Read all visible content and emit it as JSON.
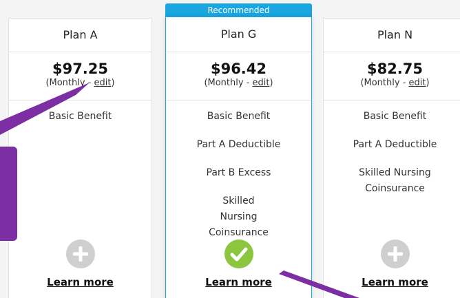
{
  "recommended_label": "Recommended",
  "plans": [
    {
      "name": "Plan A",
      "price": "$97.25",
      "monthly_prefix": "(Monthly - ",
      "edit": "edit",
      "monthly_suffix": ")",
      "benefits": [
        "Basic Benefit"
      ],
      "icon": "plus-icon",
      "learn_more": "Learn more"
    },
    {
      "name": "Plan G",
      "price": "$96.42",
      "monthly_prefix": "(Monthly - ",
      "edit": "edit",
      "monthly_suffix": ")",
      "benefits": [
        "Basic Benefit",
        "Part A Deductible",
        "Part B Excess",
        "Skilled Nursing Coinsurance"
      ],
      "icon": "check-icon",
      "learn_more": "Learn more"
    },
    {
      "name": "Plan N",
      "price": "$82.75",
      "monthly_prefix": "(Monthly - ",
      "edit": "edit",
      "monthly_suffix": ")",
      "benefits": [
        "Basic Benefit",
        "Part A Deductible",
        "Skilled Nursing Coinsurance"
      ],
      "icon": "plus-icon",
      "learn_more": "Learn more"
    }
  ],
  "colors": {
    "accent_blue": "#1aa6e0",
    "callout_purple": "#7b2fa3",
    "check_green": "#8cc63f",
    "plus_gray": "#cfcfcf"
  }
}
